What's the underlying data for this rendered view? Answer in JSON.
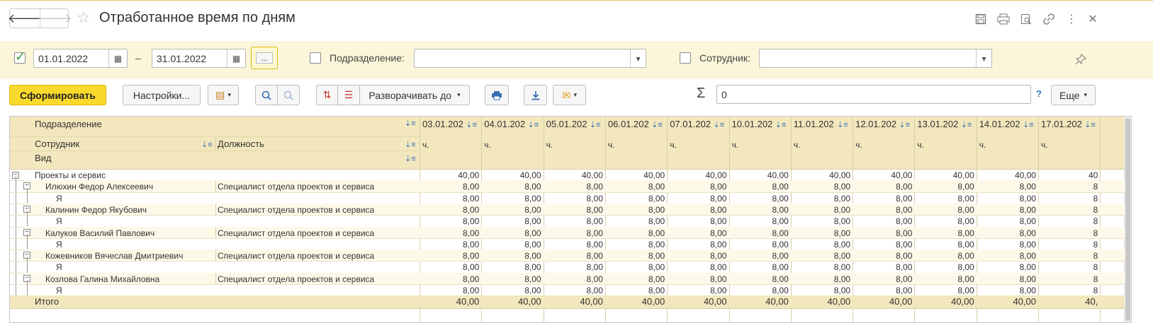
{
  "window": {
    "title": "Отработанное время по дням"
  },
  "filters": {
    "period_enabled": true,
    "date_from": "01.01.2022",
    "date_dash": "–",
    "date_to": "31.01.2022",
    "period_button": "...",
    "department_label": "Подразделение:",
    "department_value": "",
    "employee_label": "Сотрудник:",
    "employee_value": ""
  },
  "toolbar": {
    "generate": "Сформировать",
    "settings": "Настройки...",
    "expand_to": "Разворачивать до",
    "sigma": "Σ",
    "sum_value": "0",
    "help": "?",
    "more": "Еще"
  },
  "report": {
    "header": {
      "department": "Подразделение",
      "employee": "Сотрудник",
      "position": "Должность",
      "kind": "Вид",
      "unit": "ч.",
      "dates": [
        "03.01.202",
        "04.01.202",
        "05.01.202",
        "06.01.202",
        "07.01.202",
        "10.01.202",
        "11.01.202",
        "12.01.202",
        "13.01.202",
        "14.01.202",
        "17.01.202"
      ]
    },
    "group": {
      "name": "Проекты и сервис",
      "values": [
        "40,00",
        "40,00",
        "40,00",
        "40,00",
        "40,00",
        "40,00",
        "40,00",
        "40,00",
        "40,00",
        "40,00",
        "40"
      ]
    },
    "employees": [
      {
        "name": "Илюхин Федор Алексеевич",
        "position": "Специалист отдела проектов и сервиса",
        "kind": "Я",
        "values": [
          "8,00",
          "8,00",
          "8,00",
          "8,00",
          "8,00",
          "8,00",
          "8,00",
          "8,00",
          "8,00",
          "8,00",
          "8"
        ],
        "kind_values": [
          "8,00",
          "8,00",
          "8,00",
          "8,00",
          "8,00",
          "8,00",
          "8,00",
          "8,00",
          "8,00",
          "8,00",
          "8"
        ]
      },
      {
        "name": "Калинин Федор Якубович",
        "position": "Специалист отдела проектов и сервиса",
        "kind": "Я",
        "values": [
          "8,00",
          "8,00",
          "8,00",
          "8,00",
          "8,00",
          "8,00",
          "8,00",
          "8,00",
          "8,00",
          "8,00",
          "8"
        ],
        "kind_values": [
          "8,00",
          "8,00",
          "8,00",
          "8,00",
          "8,00",
          "8,00",
          "8,00",
          "8,00",
          "8,00",
          "8,00",
          "8"
        ]
      },
      {
        "name": "Калуков Василий Павлович",
        "position": "Специалист отдела проектов и сервиса",
        "kind": "Я",
        "values": [
          "8,00",
          "8,00",
          "8,00",
          "8,00",
          "8,00",
          "8,00",
          "8,00",
          "8,00",
          "8,00",
          "8,00",
          "8"
        ],
        "kind_values": [
          "8,00",
          "8,00",
          "8,00",
          "8,00",
          "8,00",
          "8,00",
          "8,00",
          "8,00",
          "8,00",
          "8,00",
          "8"
        ]
      },
      {
        "name": "Кожевников Вячеслав Дмитриевич",
        "position": "Специалист отдела проектов и сервиса",
        "kind": "Я",
        "values": [
          "8,00",
          "8,00",
          "8,00",
          "8,00",
          "8,00",
          "8,00",
          "8,00",
          "8,00",
          "8,00",
          "8,00",
          "8"
        ],
        "kind_values": [
          "8,00",
          "8,00",
          "8,00",
          "8,00",
          "8,00",
          "8,00",
          "8,00",
          "8,00",
          "8,00",
          "8,00",
          "8"
        ]
      },
      {
        "name": "Козлова Галина Михайловна",
        "position": "Специалист отдела проектов и сервиса",
        "kind": "Я",
        "values": [
          "8,00",
          "8,00",
          "8,00",
          "8,00",
          "8,00",
          "8,00",
          "8,00",
          "8,00",
          "8,00",
          "8,00",
          "8"
        ],
        "kind_values": [
          "8,00",
          "8,00",
          "8,00",
          "8,00",
          "8,00",
          "8,00",
          "8,00",
          "8,00",
          "8,00",
          "8,00",
          "8"
        ]
      }
    ],
    "total": {
      "label": "Итого",
      "values": [
        "40,00",
        "40,00",
        "40,00",
        "40,00",
        "40,00",
        "40,00",
        "40,00",
        "40,00",
        "40,00",
        "40,00",
        "40,"
      ]
    }
  },
  "colors": {
    "accent_yellow": "#f9d92b",
    "filter_bg": "#fbf6d9",
    "header_bg": "#f2e7bd",
    "check_green": "#2d9a33"
  }
}
